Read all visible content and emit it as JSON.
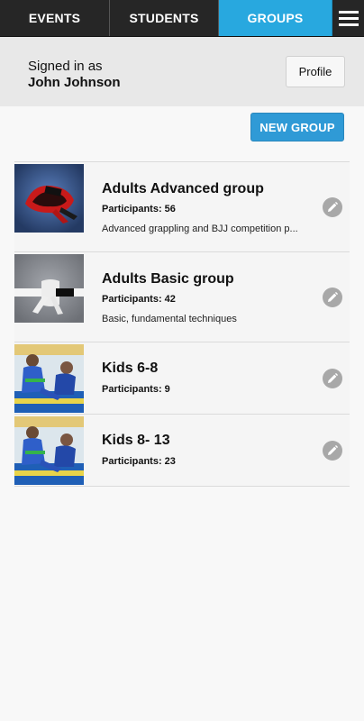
{
  "nav": {
    "tabs": [
      {
        "label": "EVENTS",
        "active": false
      },
      {
        "label": "STUDENTS",
        "active": false
      },
      {
        "label": "GROUPS",
        "active": true
      }
    ],
    "menu_icon": "hamburger-menu-icon",
    "active_color": "#28a8df"
  },
  "user": {
    "signed_in_label": "Signed in as",
    "name": "John Johnson",
    "profile_label": "Profile"
  },
  "actions": {
    "new_group_label": "NEW GROUP",
    "accent": "#2f9ad6"
  },
  "groups": [
    {
      "name": "Adults Advanced group",
      "participants_label": "Participants: 56",
      "description": "Advanced grappling and BJJ competition p...",
      "thumbnail": "red-black-belt-image",
      "edit_icon": "pencil-icon"
    },
    {
      "name": "Adults Basic group",
      "participants_label": "Participants: 42",
      "description": "Basic, fundamental techniques",
      "thumbnail": "white-belt-image",
      "edit_icon": "pencil-icon"
    },
    {
      "name": "Kids 6-8",
      "participants_label": "Participants: 9",
      "thumbnail": "kids-grappling-image",
      "edit_icon": "pencil-icon"
    },
    {
      "name": "Kids 8- 13",
      "participants_label": "Participants: 23",
      "thumbnail": "kids-grappling-image",
      "edit_icon": "pencil-icon"
    }
  ]
}
